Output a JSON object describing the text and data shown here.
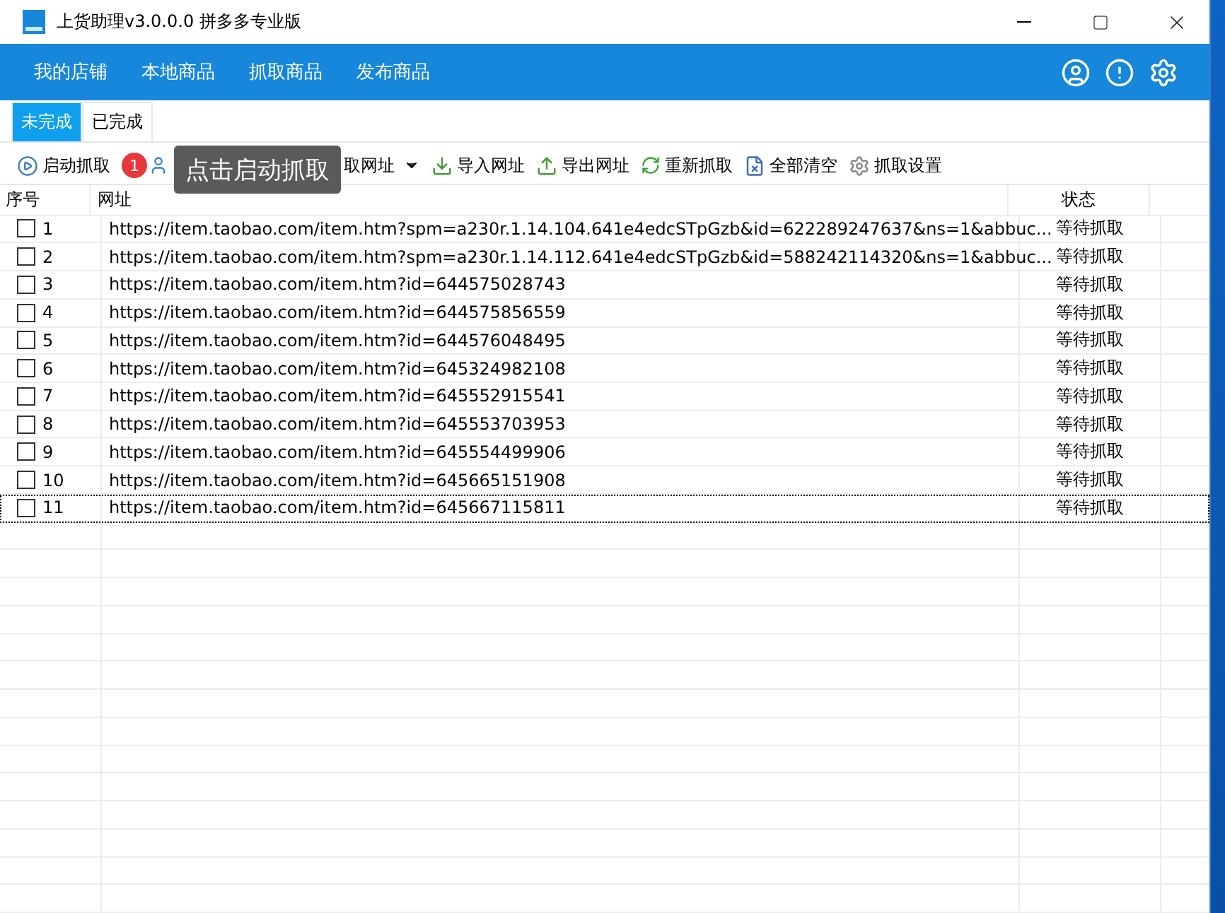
{
  "window": {
    "title": "上货助理v3.0.0.0 拼多多专业版"
  },
  "nav": {
    "items": [
      "我的店铺",
      "本地商品",
      "抓取商品",
      "发布商品"
    ]
  },
  "tabs": [
    {
      "label": "未完成",
      "selected": true
    },
    {
      "label": "已完成",
      "selected": false
    }
  ],
  "toolbar": {
    "items": [
      {
        "kind": "play",
        "label": "启动抓取"
      },
      {
        "kind": "tip",
        "badge": "1",
        "tooltip": "点击启动抓取"
      },
      {
        "kind": "extract",
        "label": "取网址",
        "dropdown": true
      },
      {
        "kind": "import",
        "label": "导入网址"
      },
      {
        "kind": "export",
        "label": "导出网址"
      },
      {
        "kind": "refresh",
        "label": "重新抓取"
      },
      {
        "kind": "clear",
        "label": "全部清空"
      },
      {
        "kind": "settings",
        "label": "抓取设置"
      }
    ]
  },
  "table": {
    "columns": [
      "序号",
      "网址",
      "状态"
    ],
    "rows": [
      {
        "index": "1",
        "url": "https://item.taobao.com/item.htm?spm=a230r.1.14.104.641e4edcSTpGzb&id=622289247637&ns=1&abbuc...",
        "status": "等待抓取",
        "checked": false,
        "focused": false
      },
      {
        "index": "2",
        "url": "https://item.taobao.com/item.htm?spm=a230r.1.14.112.641e4edcSTpGzb&id=588242114320&ns=1&abbuc...",
        "status": "等待抓取",
        "checked": false,
        "focused": false
      },
      {
        "index": "3",
        "url": "https://item.taobao.com/item.htm?id=644575028743",
        "status": "等待抓取",
        "checked": false,
        "focused": false
      },
      {
        "index": "4",
        "url": "https://item.taobao.com/item.htm?id=644575856559",
        "status": "等待抓取",
        "checked": false,
        "focused": false
      },
      {
        "index": "5",
        "url": "https://item.taobao.com/item.htm?id=644576048495",
        "status": "等待抓取",
        "checked": false,
        "focused": false
      },
      {
        "index": "6",
        "url": "https://item.taobao.com/item.htm?id=645324982108",
        "status": "等待抓取",
        "checked": false,
        "focused": false
      },
      {
        "index": "7",
        "url": "https://item.taobao.com/item.htm?id=645552915541",
        "status": "等待抓取",
        "checked": false,
        "focused": false
      },
      {
        "index": "8",
        "url": "https://item.taobao.com/item.htm?id=645553703953",
        "status": "等待抓取",
        "checked": false,
        "focused": false
      },
      {
        "index": "9",
        "url": "https://item.taobao.com/item.htm?id=645554499906",
        "status": "等待抓取",
        "checked": false,
        "focused": false
      },
      {
        "index": "10",
        "url": "https://item.taobao.com/item.htm?id=645665151908",
        "status": "等待抓取",
        "checked": false,
        "focused": false
      },
      {
        "index": "11",
        "url": "https://item.taobao.com/item.htm?id=645667115811",
        "status": "等待抓取",
        "checked": false,
        "focused": true
      }
    ]
  }
}
